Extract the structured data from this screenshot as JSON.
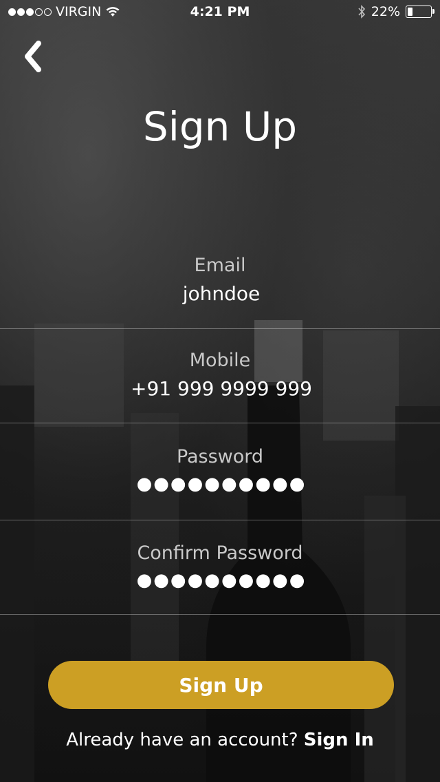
{
  "status_bar": {
    "carrier": "VIRGIN",
    "time": "4:21 PM",
    "battery_percent": "22%",
    "battery_level": 0.22,
    "signal_bars": 3,
    "signal_max": 5
  },
  "header": {
    "back_icon": "chevron-left-icon",
    "title": "Sign Up"
  },
  "form": {
    "email": {
      "label": "Email",
      "value": "johndoe"
    },
    "mobile": {
      "label": "Mobile",
      "value": "+91 999 9999 999"
    },
    "password": {
      "label": "Password",
      "value": "●●●●●●●●●●"
    },
    "confirm_password": {
      "label": "Confirm Password",
      "value": "●●●●●●●●●●"
    }
  },
  "actions": {
    "signup_label": "Sign Up"
  },
  "footer": {
    "prompt": "Already have an account?",
    "link": "Sign In"
  },
  "colors": {
    "accent": "#cc9f24",
    "text": "#ffffff",
    "label": "#c9c9c9"
  }
}
